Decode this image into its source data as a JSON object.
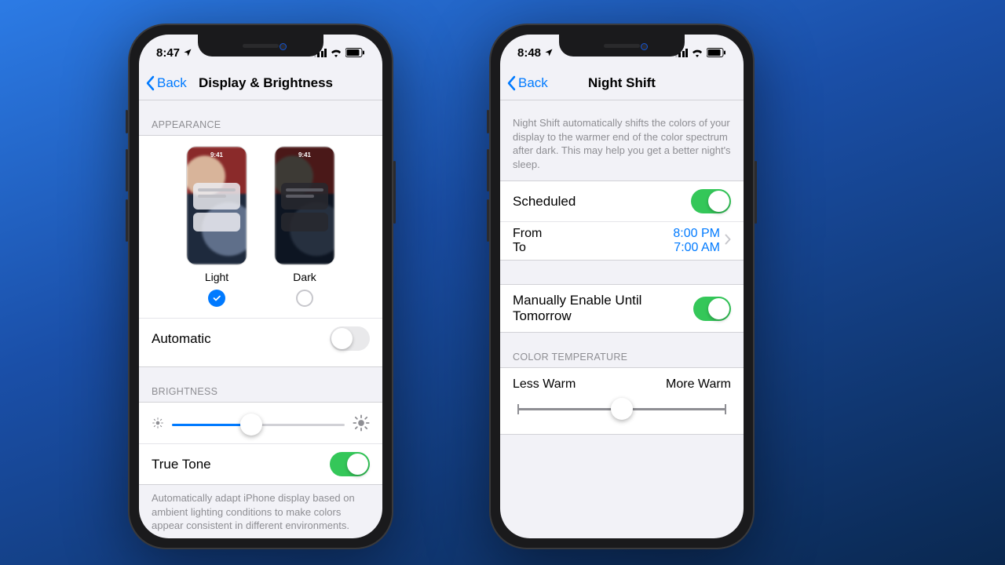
{
  "left": {
    "status_time": "8:47",
    "nav_back": "Back",
    "nav_title": "Display & Brightness",
    "sections": {
      "appearance_header": "APPEARANCE",
      "light_label": "Light",
      "dark_label": "Dark",
      "thumb_time": "9:41",
      "light_selected": true,
      "automatic_label": "Automatic",
      "automatic_on": false,
      "brightness_header": "BRIGHTNESS",
      "brightness_value_pct": 46,
      "truetone_label": "True Tone",
      "truetone_on": true,
      "truetone_desc": "Automatically adapt iPhone display based on ambient lighting conditions to make colors appear consistent in different environments."
    }
  },
  "right": {
    "status_time": "8:48",
    "nav_back": "Back",
    "nav_title": "Night Shift",
    "desc": "Night Shift automatically shifts the colors of your display to the warmer end of the color spectrum after dark. This may help you get a better night's sleep.",
    "scheduled_label": "Scheduled",
    "scheduled_on": true,
    "from_label": "From",
    "to_label": "To",
    "from_value": "8:00 PM",
    "to_value": "7:00 AM",
    "manual_label": "Manually Enable Until Tomorrow",
    "manual_on": true,
    "color_temp_header": "COLOR TEMPERATURE",
    "less_warm_label": "Less Warm",
    "more_warm_label": "More Warm",
    "color_temp_value_pct": 50
  },
  "colors": {
    "accent": "#007aff",
    "green": "#34c759"
  }
}
